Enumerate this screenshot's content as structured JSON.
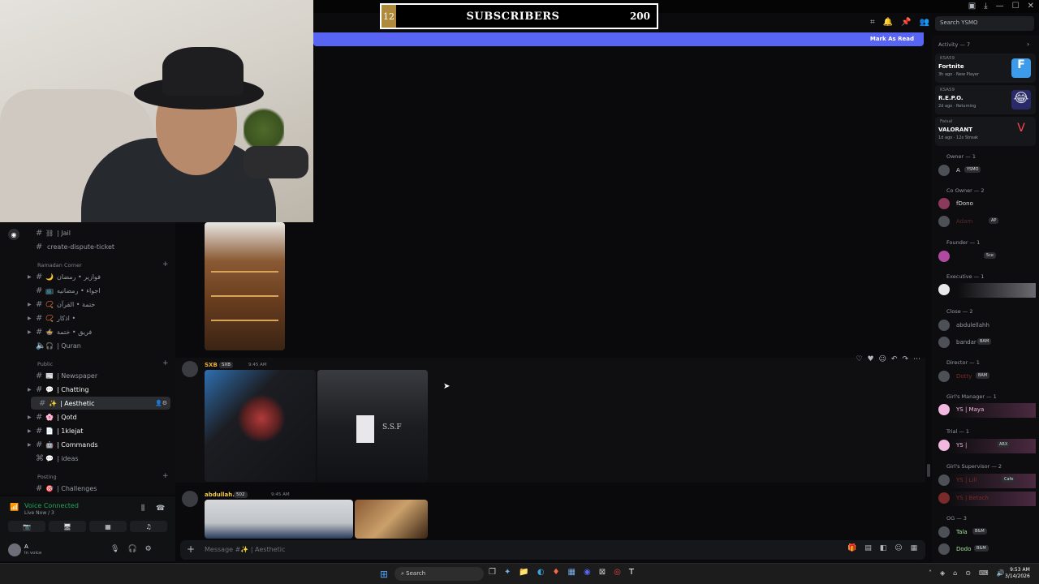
{
  "overlay": {
    "subscribers": {
      "current": "12",
      "label": "SUBSCRIBERS",
      "goal": "200"
    },
    "window_title": "YSMO"
  },
  "header": {
    "search_placeholder": "Search YSMO",
    "mark_as_read": "Mark As Read"
  },
  "sidebar": {
    "channels_top": [
      {
        "emoji": "⛓",
        "name": "| Jail"
      },
      {
        "emoji": "",
        "name": "create-dispute-ticket"
      }
    ],
    "ramadan": {
      "category": "Ramadan Corner",
      "channels": [
        {
          "emoji": "🌙",
          "name": "فوازير • رمضان"
        },
        {
          "emoji": "📺",
          "name": "اجواء • رمضانيه"
        },
        {
          "emoji": "📿",
          "name": "ختمة • القرآن"
        },
        {
          "emoji": "📿",
          "name": "اذكار •"
        },
        {
          "emoji": "🍲",
          "name": "فريق • ختمة"
        },
        {
          "emoji": "🎧",
          "name": "| Quran"
        }
      ]
    },
    "public": {
      "category": "Public",
      "channels": [
        {
          "emoji": "📰",
          "name": "| Newspaper"
        },
        {
          "emoji": "💬",
          "name": "| Chatting"
        },
        {
          "emoji": "✨",
          "name": "| Aesthetic"
        },
        {
          "emoji": "🌸",
          "name": "| Qotd"
        },
        {
          "emoji": "📄",
          "name": "| 1klejat"
        },
        {
          "emoji": "🤖",
          "name": "| Commands"
        },
        {
          "emoji": "💬",
          "name": "| ideas"
        }
      ]
    },
    "posting": {
      "category": "Posting",
      "channels": [
        {
          "emoji": "🎯",
          "name": "| Challenges"
        }
      ]
    },
    "voice": {
      "status": "Voice Connected",
      "sub": "Live Now / 3"
    },
    "user": {
      "name": "A",
      "status": "In voice"
    }
  },
  "chat": {
    "messages": [
      {
        "author": "SXB",
        "tag": "SXB",
        "time": "9:45 AM",
        "color": "#f0b232"
      },
      {
        "author": "abdullah.",
        "tag": "502",
        "time": "9:45 AM",
        "color": "#f2c94c"
      }
    ],
    "hoodie_text": "S.S.F",
    "composer_placeholder": "Message #✨ | Aesthetic"
  },
  "members": {
    "activity_title": "Activity — 7",
    "activities": [
      {
        "user": "KSA59",
        "game": "Fortnite",
        "meta": "3h ago · New Player",
        "color": "#3d9be9"
      },
      {
        "user": "KSA59",
        "game": "R.E.P.O.",
        "meta": "2d ago · Returning",
        "color": "#2a2a6a"
      },
      {
        "user": "Faisal",
        "game": "VALORANT",
        "meta": "1d ago · 12x Streak",
        "color": "#16171a"
      }
    ],
    "roles": [
      {
        "title": "Owner — 1",
        "members": [
          {
            "name": "A",
            "tag": "YSMO",
            "color": "#dbdee1"
          }
        ]
      },
      {
        "title": "Co Owner — 2",
        "members": [
          {
            "name": "fDono",
            "tag": "",
            "color": "#dbdee1"
          },
          {
            "name": "Adam",
            "tag": "AP",
            "color": "#5a2a2a"
          }
        ]
      },
      {
        "title": "Founder — 1",
        "members": [
          {
            "name": "",
            "tag": "5ce",
            "color": "#dbdee1"
          }
        ]
      },
      {
        "title": "Executive — 1",
        "members": [
          {
            "name": "",
            "tag": "",
            "color": "#dbdee1"
          }
        ]
      },
      {
        "title": "Close — 2",
        "members": [
          {
            "name": "abdulellahh",
            "tag": "",
            "color": "#949ba4"
          },
          {
            "name": "bandar",
            "tag": "BAM",
            "color": "#949ba4"
          }
        ]
      },
      {
        "title": "Director — 1",
        "members": [
          {
            "name": "Dotty",
            "tag": "BAM",
            "color": "#7a2a2a"
          }
        ]
      },
      {
        "title": "Girl's Manager — 1",
        "members": [
          {
            "name": "YS | Maya",
            "tag": "",
            "color": "#f2b8e0"
          }
        ]
      },
      {
        "title": "Trial — 1",
        "members": [
          {
            "name": "YS |",
            "tag": "ARX",
            "color": "#f2b8e0"
          }
        ]
      },
      {
        "title": "Girl's Supervisor — 2",
        "members": [
          {
            "name": "YS | Lill",
            "tag": "Cafe",
            "color": "#7a2a2a"
          },
          {
            "name": "YS | Betach",
            "tag": "",
            "color": "#7a2a2a"
          }
        ]
      },
      {
        "title": "OG — 3",
        "members": [
          {
            "name": "Tala",
            "tag": "B&M",
            "color": "#a6e3a1"
          },
          {
            "name": "Dodo",
            "tag": "B&M",
            "color": "#a6e3a1"
          }
        ]
      }
    ]
  },
  "taskbar": {
    "search": "Search",
    "time": "9:53 AM",
    "date": "3/14/2026"
  }
}
